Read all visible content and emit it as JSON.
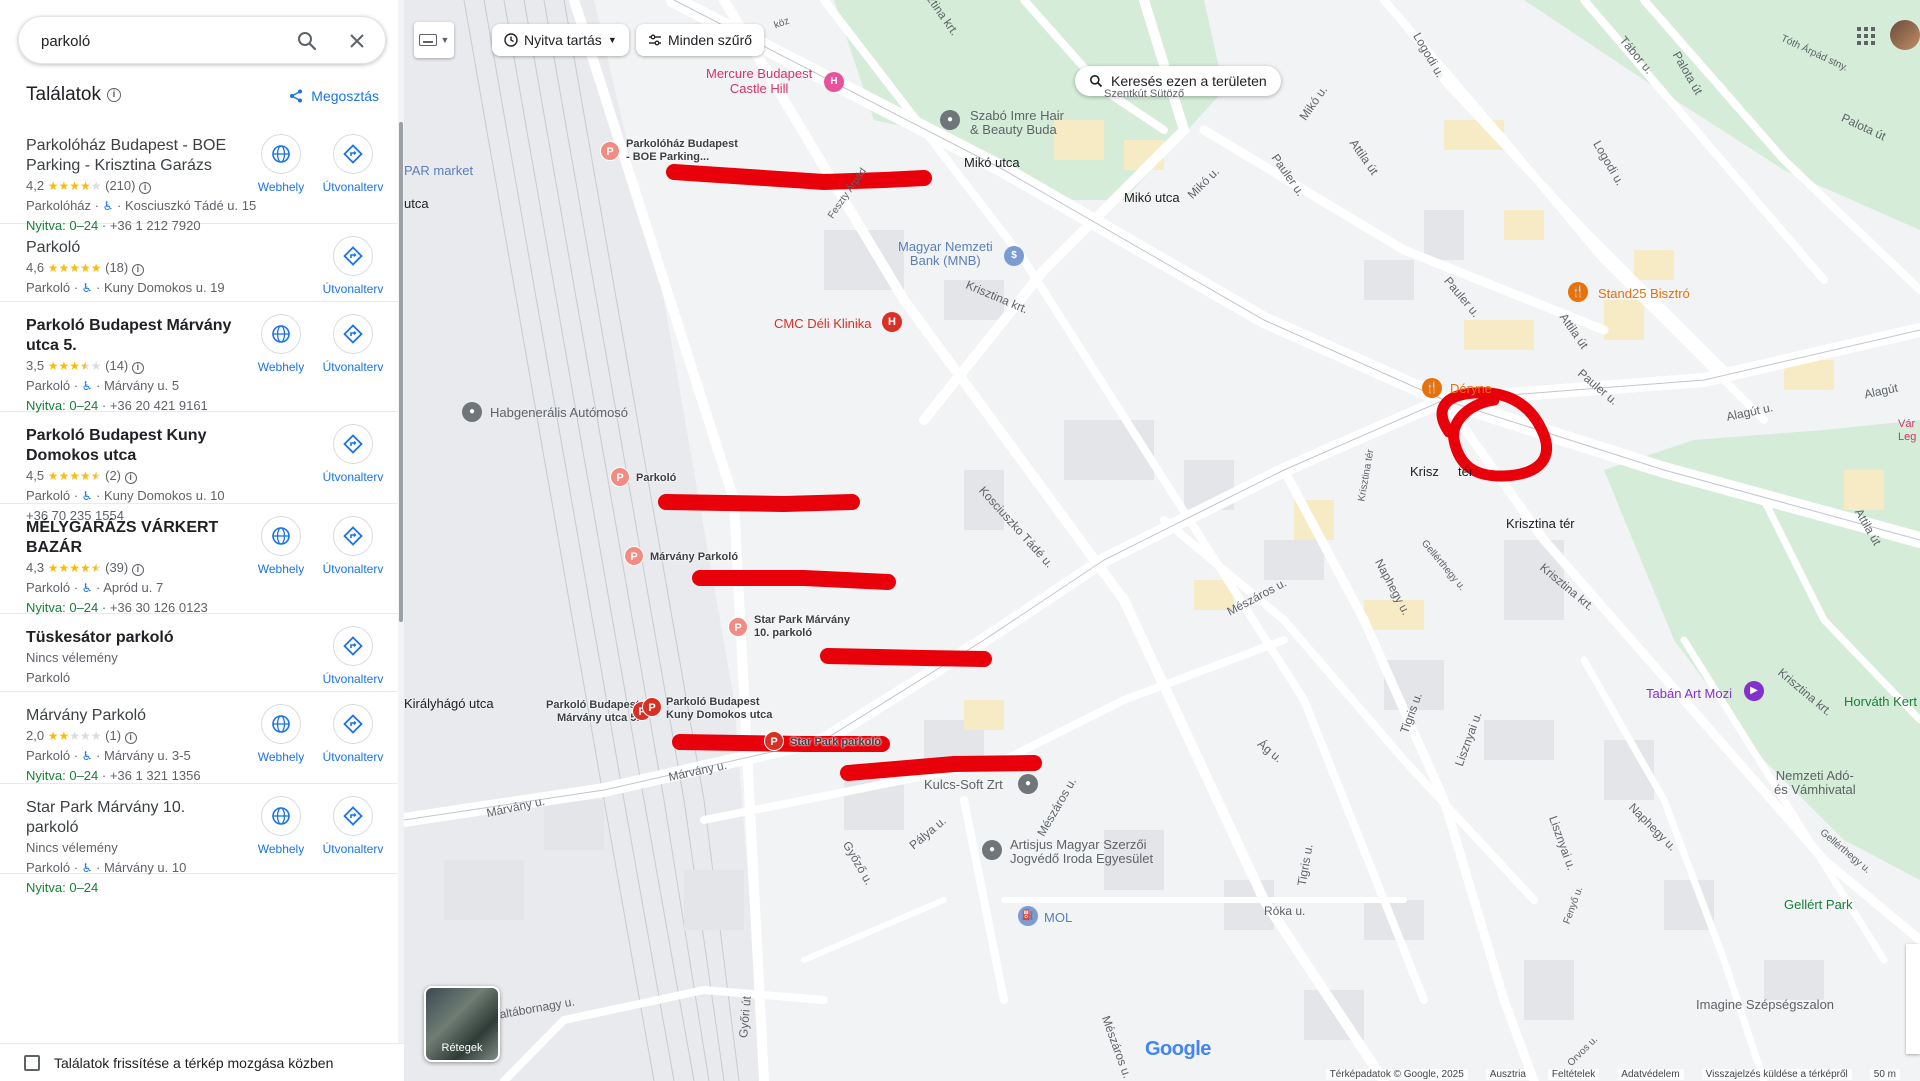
{
  "search": {
    "value": "parkoló"
  },
  "results_header": {
    "title": "Találatok",
    "share_label": "Megosztás"
  },
  "actions": {
    "website": "Webhely",
    "route": "Útvonalterv"
  },
  "results": [
    {
      "name": "Parkolóház Budapest - BOE Parking - Krisztina Garázs",
      "bold": false,
      "rating": "4,2",
      "stars": 4,
      "reviews": "(210)",
      "category": "Parkolóház",
      "address": "Kosciuszkó Tádé u. 15",
      "hours": "Nyitva: 0–24",
      "phone": "+36 1 212 7920",
      "website": true
    },
    {
      "name": "Parkoló",
      "bold": false,
      "rating": "4,6",
      "stars": 5,
      "reviews": "(18)",
      "category": "Parkoló",
      "address": "Kuny Domokos u. 19",
      "hours": "",
      "phone": "",
      "website": false
    },
    {
      "name": "Parkoló Budapest Márvány utca 5.",
      "bold": true,
      "rating": "3,5",
      "stars": 3.5,
      "reviews": "(14)",
      "category": "Parkoló",
      "address": "Márvány u. 5",
      "hours": "Nyitva: 0–24",
      "phone": "+36 20 421 9161",
      "website": true
    },
    {
      "name": "Parkoló Budapest Kuny Domokos utca",
      "bold": true,
      "rating": "4,5",
      "stars": 4.5,
      "reviews": "(2)",
      "category": "Parkoló",
      "address": "Kuny Domokos u. 10",
      "hours": "",
      "phone": "+36 70 235 1554",
      "website": false
    },
    {
      "name": "MÉLYGARÁZS VÁRKERT BAZÁR",
      "bold": true,
      "rating": "4,3",
      "stars": 4.5,
      "reviews": "(39)",
      "category": "Parkoló",
      "address": "Apród u. 7",
      "hours": "Nyitva: 0–24",
      "phone": "+36 30 126 0123",
      "website": true
    },
    {
      "name": "Tüskesátor parkoló",
      "bold": true,
      "no_reviews": "Nincs vélemény",
      "category_only": "Parkoló",
      "website": false
    },
    {
      "name": "Márvány Parkoló",
      "bold": false,
      "rating": "2,0",
      "stars": 2,
      "reviews": "(1)",
      "category": "Parkoló",
      "address": "Márvány u. 3-5",
      "hours": "Nyitva: 0–24",
      "phone": "+36 1 321 1356",
      "website": true
    },
    {
      "name": "Star Park Márvány 10. parkoló",
      "bold": false,
      "no_reviews": "Nincs vélemény",
      "category": "Parkoló",
      "address": "Márvány u. 10",
      "hours": "Nyitva: 0–24",
      "phone": "",
      "website": true
    }
  ],
  "footer": {
    "label": "Találatok frissítése a térkép mozgása közben"
  },
  "map_controls": {
    "open_now": "Nyitva tartás",
    "all_filters": "Minden szűrő",
    "search_area": "Keresés ezen a területen",
    "layers": "Rétegek"
  },
  "map_labels": {
    "mercure": "Mercure Budapest\nCastle Hill",
    "szabo": "Szabó Imre Hair\n& Beauty Buda",
    "miko_utca": "Mikó utca",
    "miko_utca_stop": "Mikó utca",
    "mnb": "Magyar Nemzeti\nBank (MNB)",
    "cmc": "CMC Déli Klinika",
    "habgeneralis": "Habgenerális Autómosó",
    "par_market": "PAR market",
    "utca": "utca",
    "stand25": "Stand25 Bisztró",
    "deryne": "Déryne",
    "krisztina_ter": "Krisztina tér",
    "krisztina_ter_2": "Krisztina tér",
    "krisz_cut": "Krisz",
    "kiralyhago": "Királyhágó utca",
    "tabanart": "Tabán Art Mozi",
    "horvath": "Horváth Kert",
    "nav": "Nemzeti Adó-\nés Vámhivatal",
    "kulcs": "Kulcs-Soft Zrt",
    "artisjus": "Artisjus Magyar Szerzői\nJogvédő Iroda Egyesület",
    "mol": "MOL",
    "gellert": "Gellért Park",
    "imagine": "Imagine Szépségszalon",
    "var": "Vár\nLeg",
    "szentkuti": "Szentkút Sütöző"
  },
  "parking_pins": [
    {
      "label": "Parkolóház Budapest\n- BOE Parking..."
    },
    {
      "label": "Parkoló"
    },
    {
      "label": "Márvány Parkoló"
    },
    {
      "label": "Star Park Márvány\n10. parkoló"
    },
    {
      "label": "Parkoló Budapest\nMárvány utca 5."
    },
    {
      "label": "Parkoló Budapest\nKuny Domokos utca"
    },
    {
      "label": "Star Park parkoló"
    }
  ],
  "streets": {
    "krisztina_krt": "Krisztina krt.",
    "krisztina_krt_2": "Krisztina krt.",
    "krisztina_krt_3": "Krisztina krt.",
    "kosciuszko": "Kosciuszko Tádé u.",
    "meszaros": "Mészáros u.",
    "meszaros_2": "Mészáros u.",
    "meszaros_3": "Mészáros u.",
    "marvany": "Márvány u.",
    "marvany_2": "Márvány u.",
    "naphegy": "Naphegy u.",
    "naphegy_2": "Naphegy u.",
    "lisznyai": "Lisznyai u.",
    "lisznyai_2": "Lisznyai u.",
    "tigris": "Tigris u.",
    "tigris_2": "Tigris u.",
    "ag": "Ág u.",
    "roka": "Róka u.",
    "gyozo": "Győző u.",
    "palya": "Pálya u.",
    "gyori": "Győri út",
    "janos": "János altábornagy u.",
    "alagut": "Alagút u.",
    "alagut_2": "Alagút",
    "attila": "Attila út",
    "attila_2": "Attila út",
    "attila_3": "Attila út",
    "pauler": "Pauler u.",
    "pauler_2": "Pauler u.",
    "pauler_3": "Pauler u.",
    "miko": "Mikó u.",
    "logodi": "Logodi u.",
    "logodi_2": "Logodi u.",
    "tabor": "Tábor u.",
    "palota": "Palota út",
    "palota_2": "Palota út",
    "toth_arpad": "Tóth Árpád stny.",
    "feszty": "Feszty Árpád",
    "gellerthegy": "Gellérthegy u.",
    "gellerthegy_2": "Gellérthegy u.",
    "fenyo": "Fenyő u.",
    "orvos": "Orvos u.",
    "krisztina_ter_street": "Krisztina tér",
    "koz": "köz",
    "krisztina_krt_top": "Krisztina krt."
  },
  "attribution": {
    "data": "Térképadatok © Google, 2025",
    "country": "Ausztria",
    "terms": "Feltételek",
    "privacy": "Adatvédelem",
    "feedback": "Visszajelzés küldése a térképről",
    "scale": "50 m"
  },
  "google_logo": "Google",
  "colors": {
    "annotation": "#e8000b",
    "accent": "#1a73e8",
    "open": "#188038",
    "star": "#fbbc04",
    "park_green": "#d4ecd8"
  }
}
